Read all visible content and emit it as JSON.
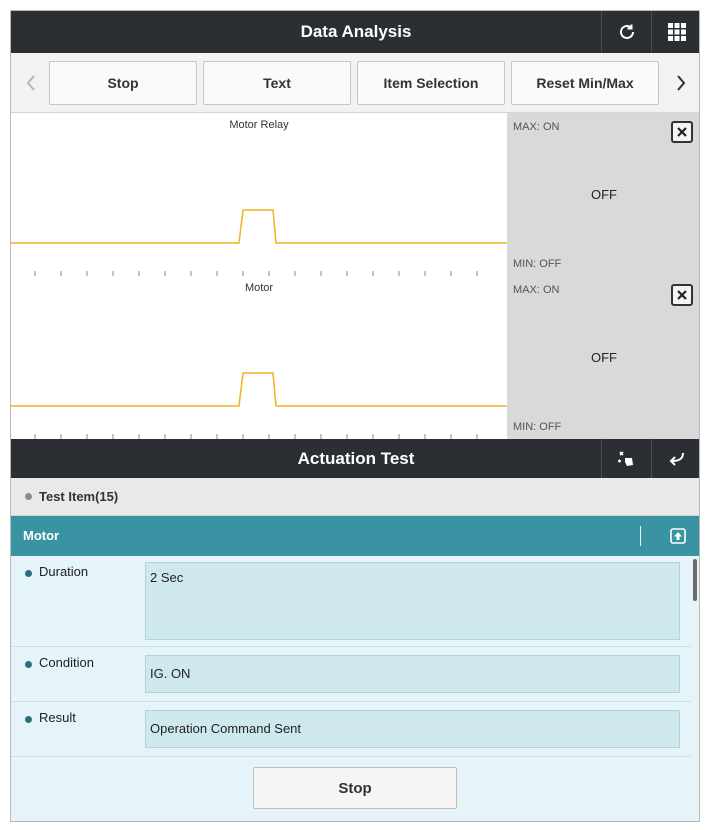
{
  "header": {
    "title": "Data Analysis"
  },
  "toolbar": {
    "buttons": [
      {
        "label": "Stop"
      },
      {
        "label": "Text"
      },
      {
        "label": "Item Selection"
      },
      {
        "label": "Reset Min/Max"
      }
    ]
  },
  "graphs": [
    {
      "title": "Motor Relay",
      "max_label": "MAX: ON",
      "min_label": "MIN: OFF",
      "current_value": "OFF"
    },
    {
      "title": "Motor",
      "max_label": "MAX: ON",
      "min_label": "MIN: OFF",
      "current_value": "OFF"
    }
  ],
  "actuation": {
    "title": "Actuation Test",
    "test_item_label": "Test Item(15)",
    "selected_item": "Motor",
    "fields": [
      {
        "label": "Duration",
        "value": "2 Sec"
      },
      {
        "label": "Condition",
        "value": "IG. ON"
      },
      {
        "label": "Result",
        "value": "Operation Command Sent"
      }
    ],
    "stop_label": "Stop"
  },
  "colors": {
    "header_bg": "#2b2e33",
    "accent_teal": "#3993a3",
    "signal_line": "#f0b323",
    "panel_bg": "#e4f4f8"
  },
  "icons": {
    "refresh": "refresh-icon",
    "grid": "grid-menu-icon",
    "touch": "touch-select-icon",
    "back": "return-arrow-icon"
  }
}
